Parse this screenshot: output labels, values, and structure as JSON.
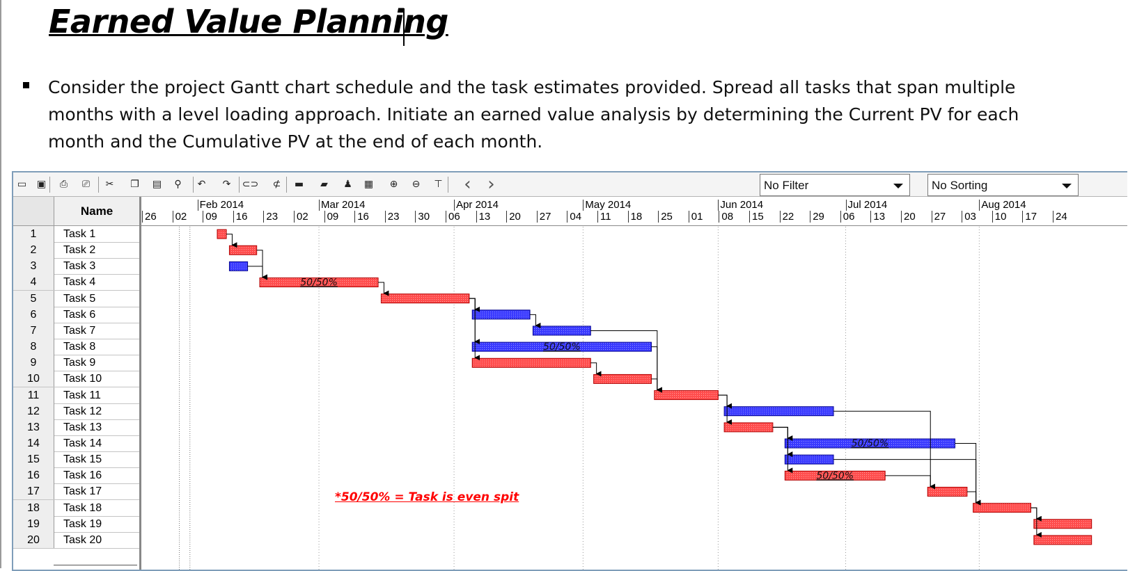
{
  "slide": {
    "title": "Earned Value Planning",
    "bullet": "Consider the project Gantt chart schedule and the task estimates provided.  Spread all tasks that span multiple months with a level loading approach.  Initiate an earned value analysis by determining the Current PV for each month and the Cumulative PV at the end of each month."
  },
  "toolbar": {
    "icons": [
      "open-icon",
      "save-icon",
      "print-icon",
      "print-preview-icon",
      "cut-icon",
      "copy-icon",
      "paste-icon",
      "find-icon",
      "undo-icon",
      "redo-icon",
      "link-icon",
      "unlink-icon",
      "task-info-icon",
      "notes-icon",
      "assign-resources-icon",
      "calendar-icon",
      "zoom-in-icon",
      "zoom-out-icon",
      "filter-icon",
      "scroll-left-icon",
      "scroll-right-icon"
    ],
    "filter_value": "No Filter",
    "sorting_value": "No Sorting"
  },
  "grid": {
    "name_header": "Name",
    "rows": [
      {
        "num": "1",
        "name": "Task 1"
      },
      {
        "num": "2",
        "name": "Task 2"
      },
      {
        "num": "3",
        "name": "Task 3"
      },
      {
        "num": "4",
        "name": "Task 4"
      },
      {
        "num": "5",
        "name": "Task 5"
      },
      {
        "num": "6",
        "name": "Task 6"
      },
      {
        "num": "7",
        "name": "Task 7"
      },
      {
        "num": "8",
        "name": "Task 8"
      },
      {
        "num": "9",
        "name": "Task 9"
      },
      {
        "num": "10",
        "name": "Task 10"
      },
      {
        "num": "11",
        "name": "Task 11"
      },
      {
        "num": "12",
        "name": "Task 12"
      },
      {
        "num": "13",
        "name": "Task 13"
      },
      {
        "num": "14",
        "name": "Task 14"
      },
      {
        "num": "15",
        "name": "Task 15"
      },
      {
        "num": "16",
        "name": "Task 16"
      },
      {
        "num": "17",
        "name": "Task 17"
      },
      {
        "num": "18",
        "name": "Task 18"
      },
      {
        "num": "19",
        "name": "Task 19"
      },
      {
        "num": "20",
        "name": "Task 20"
      }
    ]
  },
  "timeline": {
    "months": [
      "Feb 2014",
      "Mar 2014",
      "Apr 2014",
      "May 2014",
      "Jun 2014",
      "Jul 2014",
      "Aug 2014"
    ],
    "weeks": [
      "26",
      "02",
      "09",
      "16",
      "23",
      "02",
      "09",
      "16",
      "23",
      "30",
      "06",
      "13",
      "20",
      "27",
      "04",
      "11",
      "18",
      "25",
      "01",
      "08",
      "15",
      "22",
      "29",
      "06",
      "13",
      "20",
      "27",
      "03",
      "10",
      "17",
      "24"
    ]
  },
  "gantt": {
    "colors": {
      "red": "#ff4d4d",
      "blue": "#3a3aff",
      "red_border": "#b00000",
      "blue_border": "#000090"
    },
    "bar_labels": {
      "task_4": "50/50%",
      "task_8": "50/50%",
      "task_14": "50/50%",
      "task_16": "50/50%"
    },
    "tasks": [
      {
        "task": 1,
        "start_week": 2.5,
        "end_week": 2.8,
        "color": "red"
      },
      {
        "task": 2,
        "start_week": 2.9,
        "end_week": 3.8,
        "color": "red"
      },
      {
        "task": 3,
        "start_week": 2.9,
        "end_week": 3.5,
        "color": "blue"
      },
      {
        "task": 4,
        "start_week": 3.9,
        "end_week": 7.8,
        "color": "red"
      },
      {
        "task": 5,
        "start_week": 7.9,
        "end_week": 10.8,
        "color": "red"
      },
      {
        "task": 6,
        "start_week": 10.9,
        "end_week": 12.8,
        "color": "blue"
      },
      {
        "task": 7,
        "start_week": 12.9,
        "end_week": 14.8,
        "color": "blue"
      },
      {
        "task": 8,
        "start_week": 10.9,
        "end_week": 16.8,
        "color": "blue"
      },
      {
        "task": 9,
        "start_week": 10.9,
        "end_week": 14.8,
        "color": "red"
      },
      {
        "task": 10,
        "start_week": 14.9,
        "end_week": 16.8,
        "color": "red"
      },
      {
        "task": 11,
        "start_week": 16.9,
        "end_week": 19.0,
        "color": "red"
      },
      {
        "task": 12,
        "start_week": 19.2,
        "end_week": 22.8,
        "color": "blue"
      },
      {
        "task": 13,
        "start_week": 19.2,
        "end_week": 20.8,
        "color": "red"
      },
      {
        "task": 14,
        "start_week": 21.2,
        "end_week": 26.8,
        "color": "blue"
      },
      {
        "task": 15,
        "start_week": 21.2,
        "end_week": 22.8,
        "color": "blue"
      },
      {
        "task": 16,
        "start_week": 21.2,
        "end_week": 24.5,
        "color": "red"
      },
      {
        "task": 17,
        "start_week": 25.9,
        "end_week": 27.2,
        "color": "red"
      },
      {
        "task": 18,
        "start_week": 27.4,
        "end_week": 29.3,
        "color": "red"
      },
      {
        "task": 19,
        "start_week": 29.4,
        "end_week": 31.3,
        "color": "red"
      },
      {
        "task": 20,
        "start_week": 29.4,
        "end_week": 31.3,
        "color": "red"
      }
    ],
    "dependencies": [
      [
        1,
        2
      ],
      [
        2,
        4
      ],
      [
        3,
        4
      ],
      [
        4,
        5
      ],
      [
        5,
        6
      ],
      [
        6,
        7
      ],
      [
        5,
        8
      ],
      [
        5,
        9
      ],
      [
        9,
        10
      ],
      [
        7,
        11
      ],
      [
        8,
        11
      ],
      [
        10,
        11
      ],
      [
        11,
        12
      ],
      [
        11,
        13
      ],
      [
        13,
        14
      ],
      [
        13,
        15
      ],
      [
        13,
        16
      ],
      [
        12,
        17
      ],
      [
        16,
        17
      ],
      [
        14,
        18
      ],
      [
        15,
        18
      ],
      [
        17,
        18
      ],
      [
        18,
        19
      ],
      [
        18,
        20
      ]
    ],
    "note": "*50/50% = Task is even spit"
  }
}
